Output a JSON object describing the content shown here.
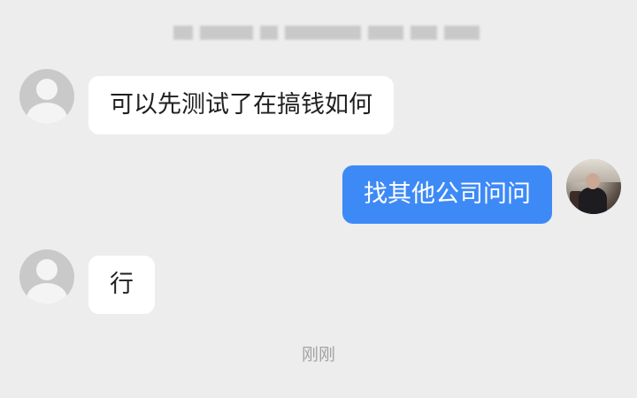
{
  "conversation": {
    "messages": [
      {
        "sender": "other",
        "text": "可以先测试了在搞钱如何"
      },
      {
        "sender": "self",
        "text": "找其他公司问问"
      },
      {
        "sender": "other",
        "text": "行"
      }
    ],
    "timestamp": "刚刚"
  },
  "colors": {
    "background": "#ededed",
    "incoming_bubble": "#ffffff",
    "outgoing_bubble": "#3d8af7",
    "timestamp_text": "#a3a3a3"
  },
  "icons": {
    "contact_avatar": "default-person-avatar-icon",
    "self_avatar": "user-photo-avatar"
  }
}
